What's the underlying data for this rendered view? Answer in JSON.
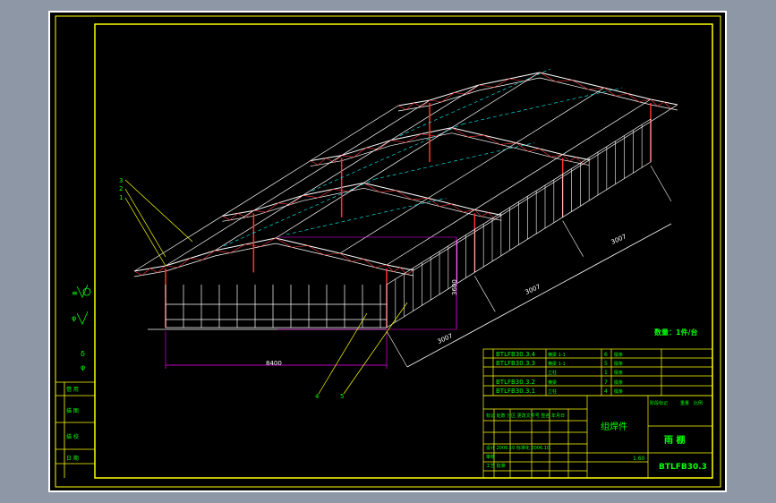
{
  "colors": {
    "background_outer": "#8e97a6",
    "sheet": "#000000",
    "sheet_border": "#ffffff",
    "frame_line": "#ffff00",
    "structure_white": "#ffffff",
    "structure_red": "#ff3333",
    "dimension_magenta": "#ff00ff",
    "cyan_dash": "#00ffff",
    "text_green": "#00ff00",
    "text_cyan": "#00ffff"
  },
  "drawing": {
    "callouts": [
      "3",
      "2",
      "1",
      "4",
      "5"
    ],
    "dimensions": {
      "width": "8400",
      "height": "3600",
      "bay1": "3007",
      "bay2": "3007",
      "bay3": "3007"
    },
    "quantity_note": "数量：1件/台"
  },
  "side_column": {
    "symbols": [
      "≡",
      "φ",
      "δ",
      "φ"
    ],
    "labels": [
      "借 用",
      "描 图",
      "描 校",
      "日 期"
    ]
  },
  "parts_list": [
    {
      "code": "BTLFB30.3.4",
      "name": "横梁 1-1",
      "no": "6",
      "part": "檩条"
    },
    {
      "code": "BTLFB30.3.3",
      "name": "横梁 1-1",
      "no": "5",
      "part": "檩条"
    },
    {
      "code": "",
      "name": "立柱",
      "no": "1",
      "part": "檩条"
    },
    {
      "code": "BTLFB30.3.2",
      "name": "横梁",
      "no": "7",
      "part": "檩条"
    },
    {
      "code": "BTLFB30.3.1",
      "name": "立柱",
      "no": "4",
      "part": "檩条"
    }
  ],
  "title_block": {
    "assembly": "组焊件",
    "part_name": "雨 棚",
    "drawing_no": "BTLFB30.3",
    "scale": "1:60",
    "rows": [
      "标记 处数 分区 更改文件号 签名 年月日",
      "设计 2006.10 标准化 2006.10",
      "审核",
      "工艺 批准"
    ],
    "small_labels": [
      "阶段标记",
      "重量",
      "比例"
    ]
  }
}
